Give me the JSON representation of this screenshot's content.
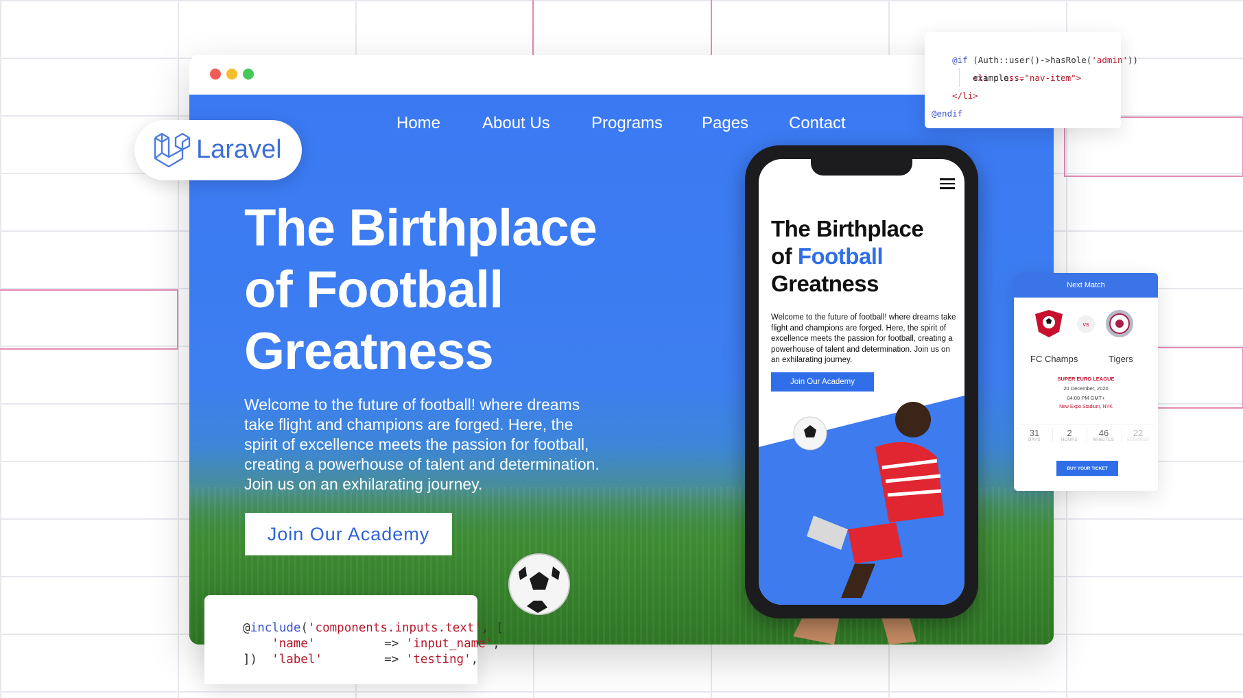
{
  "nav": {
    "items": [
      {
        "label": "Home"
      },
      {
        "label": "About Us"
      },
      {
        "label": "Programs"
      },
      {
        "label": "Pages"
      },
      {
        "label": "Contact"
      }
    ]
  },
  "hero": {
    "title_line1": "The Birthplace",
    "title_line2": "of Football",
    "title_line3": "Greatness",
    "lead": "Welcome to the future of football! where dreams take flight and champions are forged. Here, the spirit of excellence meets the passion for football, creating a powerhouse of talent and determination. Join us on an exhilarating journey.",
    "cta_label": "Join Our Academy"
  },
  "badge": {
    "logo_text": "Laravel"
  },
  "code_top": {
    "line1_kw": "@if",
    "line1_rest": " (Auth::user()->hasRole(",
    "line1_str": "'admin'",
    "line1_end": "))",
    "line2_tag": "<li ",
    "line2_attr": "class=",
    "line2_str": "\"nav-item\"",
    "line2_end": ">",
    "line3": "example...",
    "line4": "</li>",
    "line5_kw": "@endif"
  },
  "code_bottom": {
    "line1_pre": "@",
    "line1_kw": "include",
    "line1_paren": "(",
    "line1_str": "'components.inputs.text'",
    "line1_end": ", [",
    "line2_key": "'name'",
    "line2_arrow": "=>",
    "line2_val": "'input_name'",
    "line2_end": ",",
    "line3_key": "'label'",
    "line3_arrow": "=>",
    "line3_val": "'testing'",
    "line3_end": ",",
    "line4": "])"
  },
  "phone": {
    "title_line1": "The Birthplace",
    "title_of": "of ",
    "title_accent": "Football",
    "title_line3": "Greatness",
    "lead": "Welcome to the future of football! where dreams take flight and champions are forged. Here, the spirit of excellence meets the passion for football, creating a powerhouse of talent and determination. Join us on an exhilarating journey.",
    "cta_label": "Join Our Academy"
  },
  "match_card": {
    "header": "Next Match",
    "vs": "vs",
    "team_home": "FC Champs",
    "team_away": "Tigers",
    "league": "SUPER EURO LEAGUE",
    "date": "20 December, 2020",
    "time": "04:00 PM GMT+",
    "venue": "New Expo Stadium, NYK",
    "countdown": [
      {
        "value": "31",
        "label": "DAYS"
      },
      {
        "value": "2",
        "label": "HOURS"
      },
      {
        "value": "46",
        "label": "MINUTES"
      },
      {
        "value": "22",
        "label": "SECONDS"
      }
    ],
    "ticket_label": "BUY YOUR TICKET"
  },
  "colors": {
    "brand_blue": "#3b79f2",
    "accent_red": "#c8102e",
    "laravel_blue": "#3d6fd8",
    "grid_pink": "#e58bb5"
  }
}
